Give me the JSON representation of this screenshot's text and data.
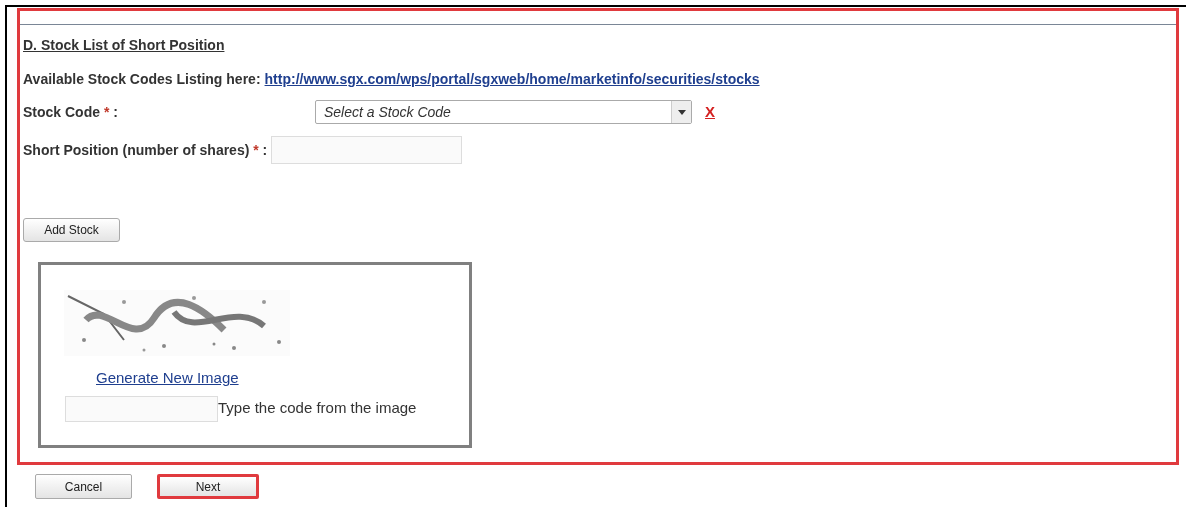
{
  "section": {
    "heading": "D. Stock List of Short Position",
    "listing_label": "Available Stock Codes Listing here:",
    "listing_link": "http://www.sgx.com/wps/portal/sgxweb/home/marketinfo/securities/stocks",
    "fields": [
      {
        "kind": "select",
        "label": "Stock Code",
        "required_mark": "*",
        "colon": ":",
        "placeholder": "Select a Stock Code",
        "clear_label": "X"
      },
      {
        "kind": "text",
        "label": "Short Position (number of shares)",
        "required_mark": "*",
        "colon": ":"
      }
    ],
    "add_button": "Add Stock",
    "highlighted": true
  },
  "captcha": {
    "link": "Generate New Image",
    "hint": "Type the code from the image"
  },
  "buttons": [
    {
      "label": "Cancel",
      "highlighted": false
    },
    {
      "label": "Next",
      "highlighted": true
    }
  ]
}
